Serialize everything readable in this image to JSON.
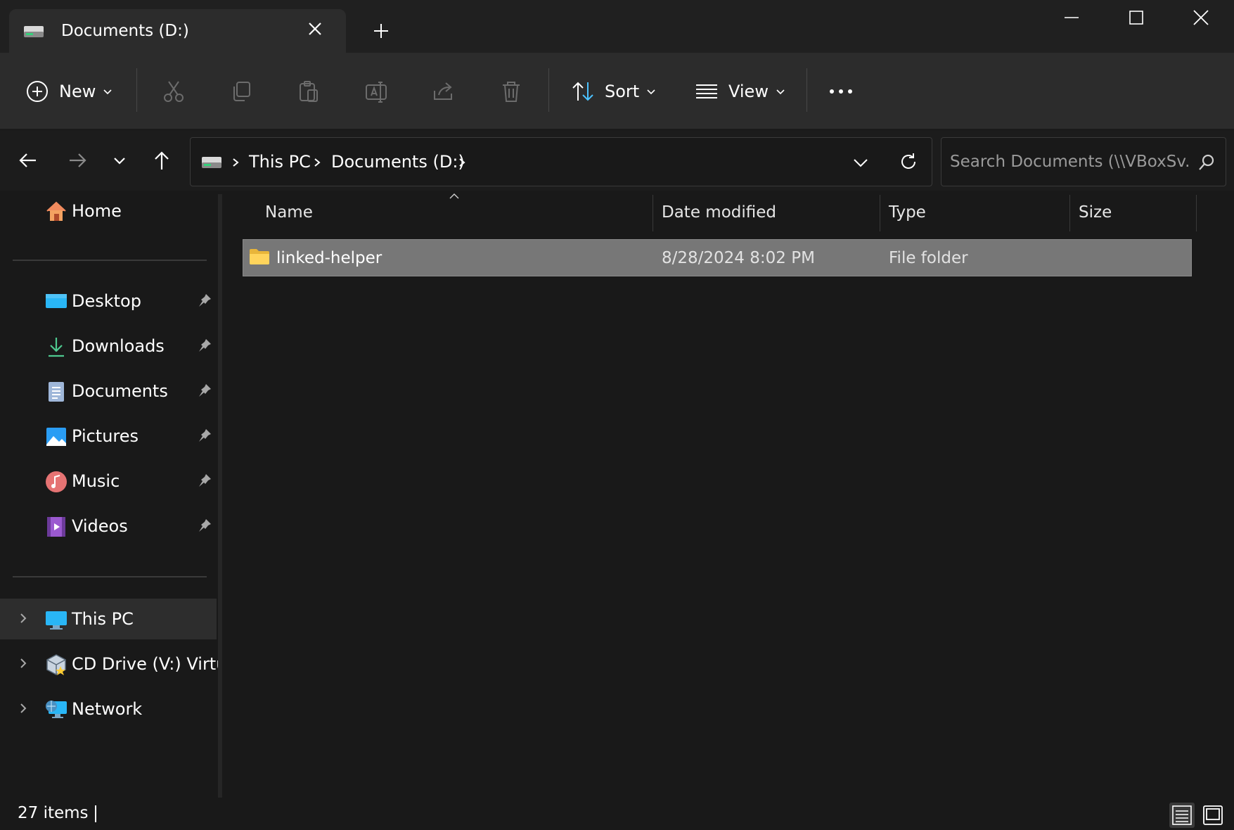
{
  "window": {
    "tab_title": "Documents (D:)",
    "colors": {
      "bg": "#191919",
      "toolbar": "#2c2c2c",
      "selected_row": "#777777",
      "accent": "#4cc2ff"
    }
  },
  "toolbar": {
    "new_label": "New",
    "sort_label": "Sort",
    "view_label": "View"
  },
  "address": {
    "crumbs": [
      "This PC",
      "Documents (D:)"
    ]
  },
  "search": {
    "placeholder": "Search Documents (\\\\VBoxSv..."
  },
  "sidebar": {
    "home": "Home",
    "pinned": [
      {
        "label": "Desktop",
        "icon": "desktop-icon"
      },
      {
        "label": "Downloads",
        "icon": "downloads-icon"
      },
      {
        "label": "Documents",
        "icon": "documents-icon"
      },
      {
        "label": "Pictures",
        "icon": "pictures-icon"
      },
      {
        "label": "Music",
        "icon": "music-icon"
      },
      {
        "label": "Videos",
        "icon": "videos-icon"
      }
    ],
    "locations": [
      {
        "label": "This PC",
        "icon": "this-pc-icon"
      },
      {
        "label": "CD Drive (V:) VirtualBox Guest Additions",
        "icon": "cd-drive-icon"
      },
      {
        "label": "Network",
        "icon": "network-icon"
      }
    ]
  },
  "columns": {
    "name": "Name",
    "date": "Date modified",
    "type": "Type",
    "size": "Size"
  },
  "files": [
    {
      "name": "linked-helper",
      "date": "8/28/2024 8:02 PM",
      "type": "File folder",
      "size": ""
    }
  ],
  "status": {
    "count": "27 items"
  }
}
